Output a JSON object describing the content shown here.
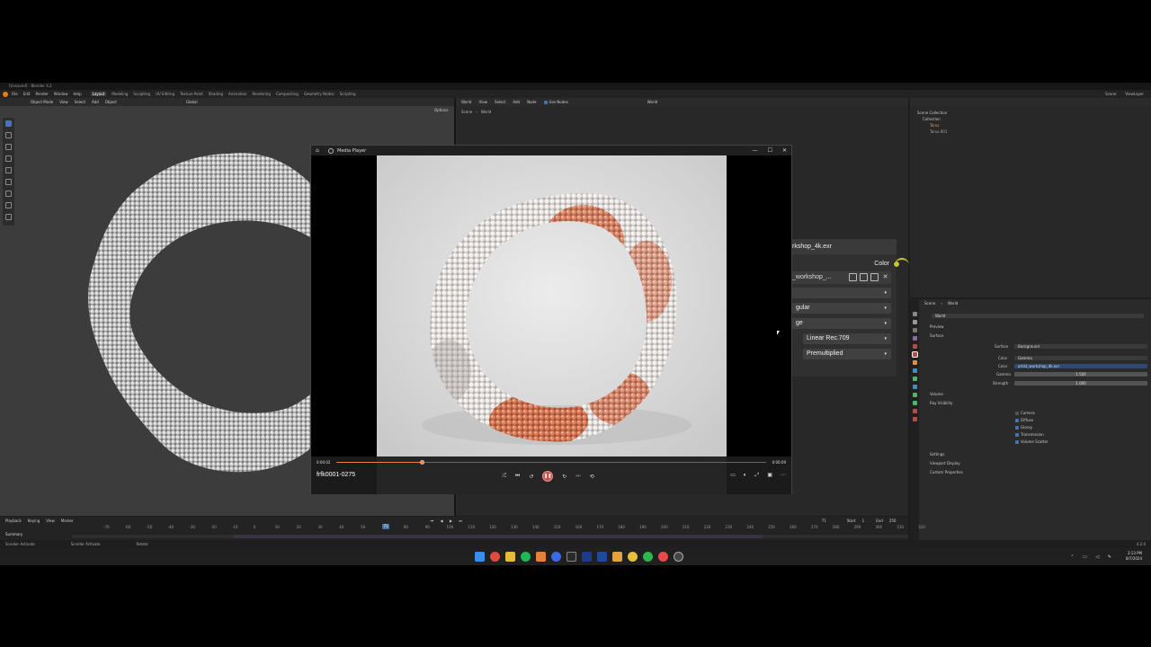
{
  "blender": {
    "title": "[Unsaved] - Blender 4.2",
    "menu": [
      "File",
      "Edit",
      "Render",
      "Window",
      "Help"
    ],
    "workspaces": [
      "Layout",
      "Modeling",
      "Sculpting",
      "UV Editing",
      "Texture Paint",
      "Shading",
      "Animation",
      "Rendering",
      "Compositing",
      "Geometry Nodes",
      "Scripting"
    ],
    "active_workspace": "Layout",
    "scene": "Scene",
    "view_layer": "ViewLayer"
  },
  "viewport": {
    "mode": "Object Mode",
    "menus": [
      "View",
      "Select",
      "Add",
      "Object"
    ],
    "transform": "Global",
    "options": "Options"
  },
  "node_editor": {
    "type": "World",
    "menus": [
      "View",
      "Select",
      "Add",
      "Node"
    ],
    "use_nodes": "Use Nodes",
    "world": "World",
    "breadcrumb": [
      "Scene",
      "World"
    ],
    "node_title": "rkshop_4k.exr",
    "color_label": "Color",
    "image_name": "_workshop_...",
    "dropdowns": [
      "gular",
      "ge",
      "Linear Rec.709",
      "Premultiplied"
    ]
  },
  "outliner": {
    "items": [
      "Scene Collection",
      "Collection",
      "Torus",
      "Torus.001"
    ]
  },
  "properties": {
    "breadcrumb": [
      "Scene",
      "World"
    ],
    "world_name": "World",
    "sections": [
      "Preview",
      "Surface",
      "Volume",
      "Ray Visibility",
      "Settings",
      "Viewport Display",
      "Custom Properties"
    ],
    "surface_label": "Surface",
    "surface_value": "Background",
    "color_label": "Color",
    "color_value": "Gamma",
    "color2_label": "Color",
    "color2_value": "artist_workshop_4k.exr",
    "gamma_label": "Gamma",
    "gamma_value": "1.500",
    "strength_label": "Strength",
    "strength_value": "1.000",
    "ray_visibility": [
      {
        "label": "Camera",
        "checked": false
      },
      {
        "label": "Diffuse",
        "checked": true
      },
      {
        "label": "Glossy",
        "checked": true
      },
      {
        "label": "Transmission",
        "checked": true
      },
      {
        "label": "Volume Scatter",
        "checked": true
      }
    ]
  },
  "timeline": {
    "menus": [
      "Playback",
      "Keying",
      "View",
      "Marker"
    ],
    "current_frame": "71",
    "start_label": "Start",
    "start": "1",
    "end_label": "End",
    "end": "250",
    "ticks": [
      "-70",
      "-60",
      "-50",
      "-40",
      "-30",
      "-20",
      "-10",
      "0",
      "10",
      "20",
      "30",
      "40",
      "50",
      "60",
      "80",
      "90",
      "100",
      "110",
      "120",
      "130",
      "140",
      "150",
      "160",
      "170",
      "180",
      "190",
      "200",
      "210",
      "220",
      "230",
      "240",
      "250",
      "260",
      "270",
      "280",
      "290",
      "300",
      "310",
      "320"
    ],
    "summary": "Summary"
  },
  "status": {
    "items": [
      "Scroller Activate",
      "Scroller Activate",
      "Rotate"
    ],
    "version": "4.2.0"
  },
  "media_player": {
    "title": "Media Player",
    "time_current": "0:00:02",
    "time_total": "0:00:09",
    "progress": 0.2,
    "file_name": "frfk0001-0275"
  },
  "taskbar": {
    "time": "3:13 PM",
    "date": "8/7/2024"
  },
  "colors": {
    "accent": "#e8803a",
    "blender_blue": "#4772b3",
    "socket_yellow": "#c7c729"
  }
}
